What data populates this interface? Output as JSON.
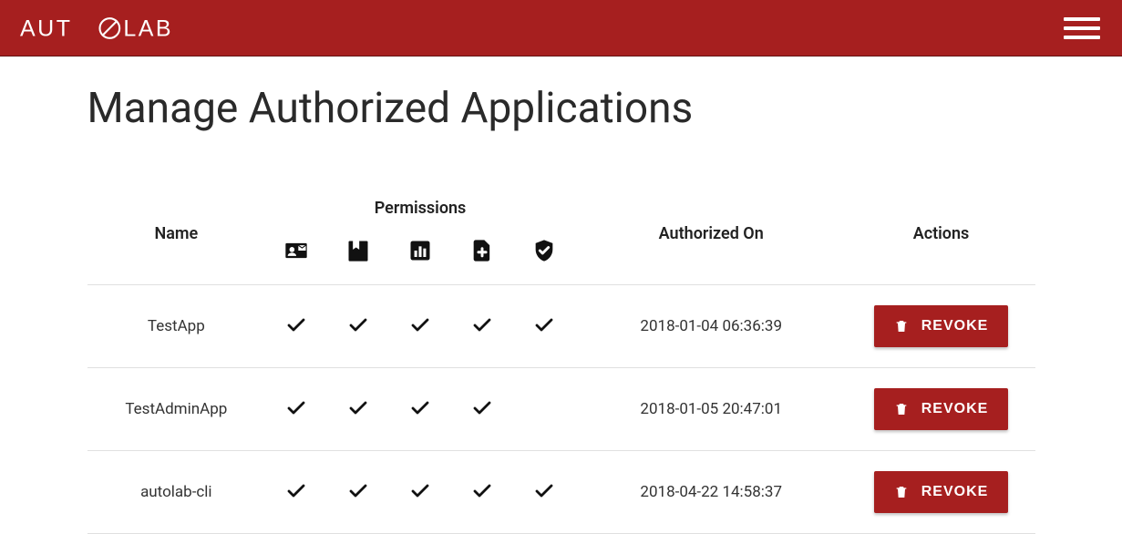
{
  "brand": "AUTOLAB",
  "page_title": "Manage Authorized Applications",
  "columns": {
    "name": "Name",
    "permissions_header": "Permissions",
    "authorized_on": "Authorized On",
    "actions": "Actions"
  },
  "permission_icons": [
    "contact-card-icon",
    "bookmark-icon",
    "chart-icon",
    "file-plus-icon",
    "shield-check-icon"
  ],
  "revoke_label": "REVOKE",
  "apps": [
    {
      "name": "TestApp",
      "perms": [
        true,
        true,
        true,
        true,
        true
      ],
      "authorized_on": "2018-01-04 06:36:39"
    },
    {
      "name": "TestAdminApp",
      "perms": [
        true,
        true,
        true,
        true,
        false
      ],
      "authorized_on": "2018-01-05 20:47:01"
    },
    {
      "name": "autolab-cli",
      "perms": [
        true,
        true,
        true,
        true,
        true
      ],
      "authorized_on": "2018-04-22 14:58:37"
    }
  ],
  "colors": {
    "brand": "#a61f1f",
    "text": "#222222"
  }
}
